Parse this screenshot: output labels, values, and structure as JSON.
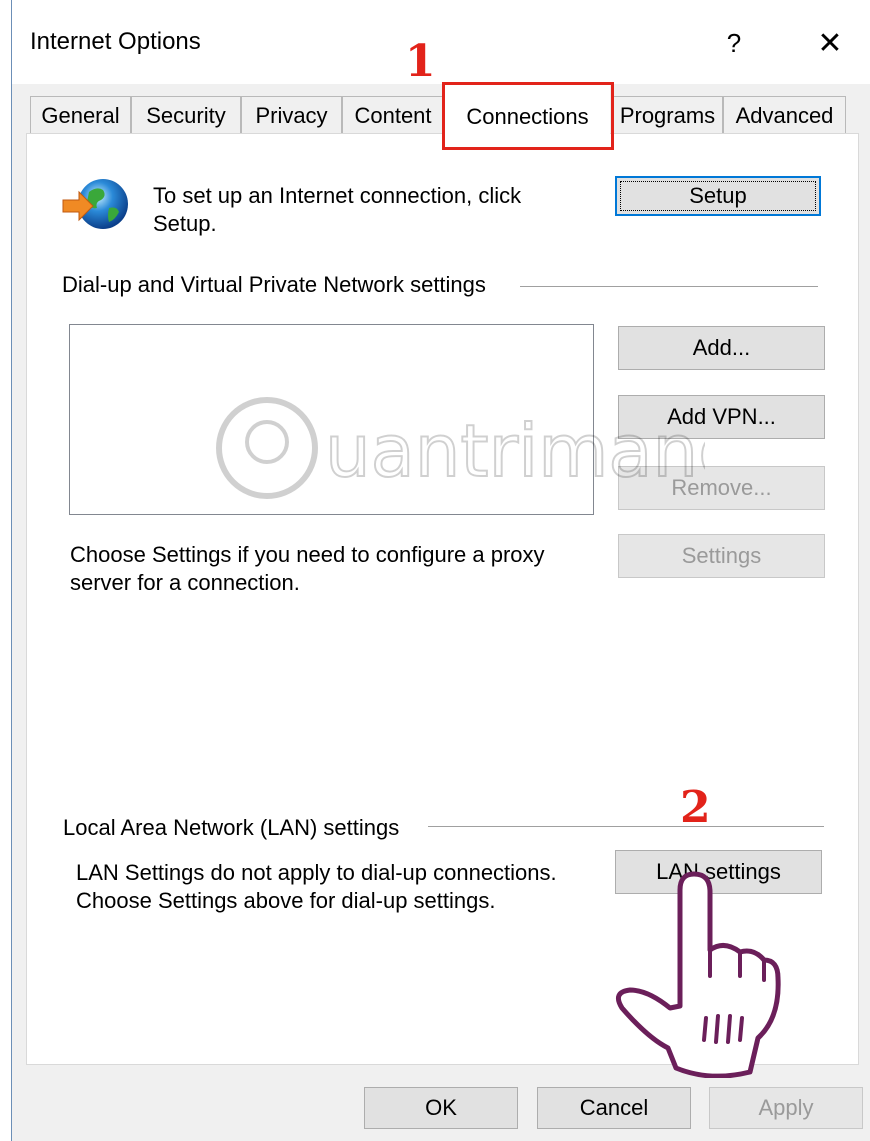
{
  "window": {
    "title": "Internet Options",
    "help": "?",
    "close": "✕"
  },
  "tabs": [
    "General",
    "Security",
    "Privacy",
    "Content",
    "Connections",
    "Programs",
    "Advanced"
  ],
  "annotations": {
    "step1": "1",
    "step2": "2",
    "highlight_color": "#e2231a"
  },
  "setup": {
    "text_line1": "To set up an Internet connection, click",
    "text_line2": "Setup.",
    "button": "Setup"
  },
  "dialup": {
    "group_label": "Dial-up and Virtual Private Network settings",
    "add": "Add...",
    "add_vpn": "Add VPN...",
    "remove": "Remove...",
    "settings": "Settings",
    "proxy_line1": "Choose Settings if you need to configure a proxy",
    "proxy_line2": "server for a connection."
  },
  "lan": {
    "group_label": "Local Area Network (LAN) settings",
    "text_line1": "LAN Settings do not apply to dial-up connections.",
    "text_line2": "Choose Settings above for dial-up settings.",
    "button": "LAN settings"
  },
  "footer": {
    "ok": "OK",
    "cancel": "Cancel",
    "apply": "Apply"
  },
  "watermark_text": "uantrimang",
  "colors": {
    "accent": "#0078d7",
    "annotation": "#e2231a",
    "hand": "#6b1f5a"
  }
}
